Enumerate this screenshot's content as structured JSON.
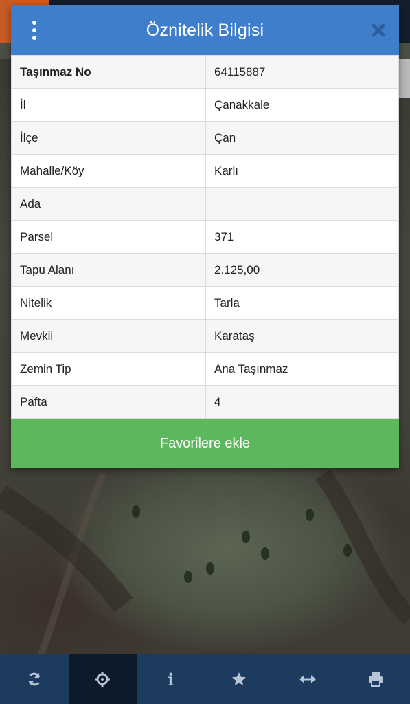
{
  "modal": {
    "title": "Öznitelik Bilgisi",
    "rows": [
      {
        "key": "Taşınmaz No",
        "value": "64115887",
        "bold": true
      },
      {
        "key": "İl",
        "value": "Çanakkale"
      },
      {
        "key": "İlçe",
        "value": "Çan"
      },
      {
        "key": "Mahalle/Köy",
        "value": "Karlı"
      },
      {
        "key": "Ada",
        "value": ""
      },
      {
        "key": "Parsel",
        "value": "371"
      },
      {
        "key": "Tapu Alanı",
        "value": "2.125,00"
      },
      {
        "key": "Nitelik",
        "value": "Tarla"
      },
      {
        "key": "Mevkii",
        "value": "Karataş"
      },
      {
        "key": "Zemin Tip",
        "value": "Ana Taşınmaz"
      },
      {
        "key": "Pafta",
        "value": "4"
      }
    ],
    "favorite_button_label": "Favorilere ekle"
  },
  "toolbar": {
    "buttons": [
      {
        "name": "refresh",
        "icon": "refresh-icon",
        "active": false
      },
      {
        "name": "locate",
        "icon": "crosshair-icon",
        "active": true
      },
      {
        "name": "info",
        "icon": "info-icon",
        "glyph": "i",
        "active": false
      },
      {
        "name": "favorites",
        "icon": "star-icon",
        "active": false
      },
      {
        "name": "measure",
        "icon": "horizontal-arrows-icon",
        "active": false
      },
      {
        "name": "print",
        "icon": "print-icon",
        "active": false
      }
    ]
  },
  "colors": {
    "header": "#3e7ecb",
    "favorite_button": "#5cb85c",
    "toolbar": "#1d3a5f",
    "toolbar_active": "#0d1a2a",
    "toolbar_icon": "#b8c5d6"
  }
}
